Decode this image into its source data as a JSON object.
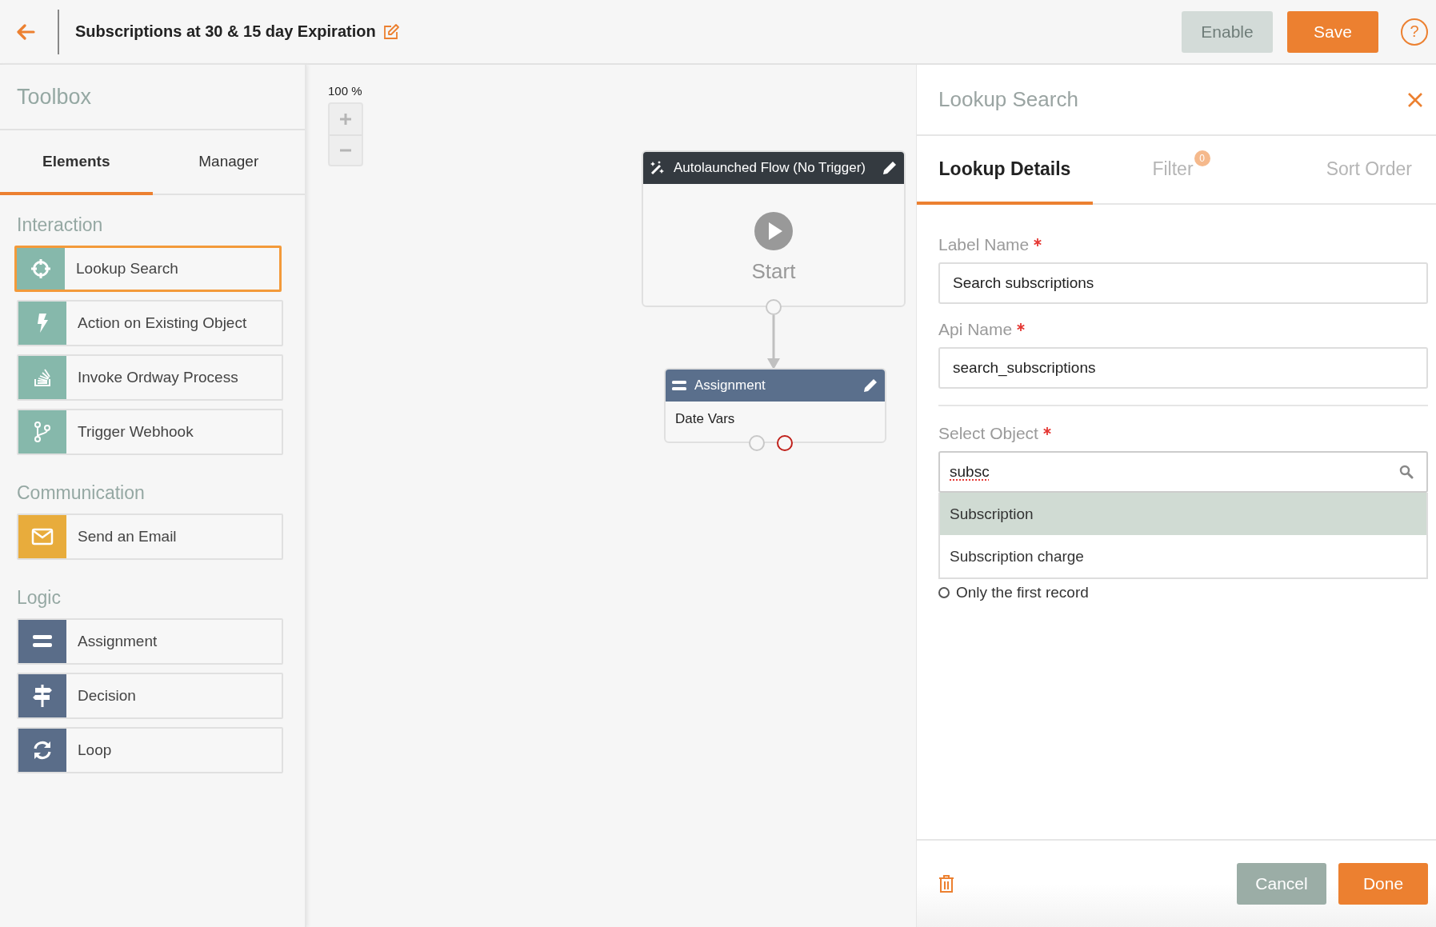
{
  "header": {
    "title": "Subscriptions at 30 & 15 day Expiration",
    "buttons": [
      {
        "label": "Enable",
        "disabled": true,
        "kind": "secondary"
      },
      {
        "label": "Save",
        "disabled": false,
        "kind": "primary"
      }
    ],
    "help": "?"
  },
  "toolbox": {
    "title": "Toolbox",
    "tabs": [
      {
        "label": "Elements",
        "selected": true
      },
      {
        "label": "Manager",
        "selected": false
      }
    ],
    "sections": [
      {
        "title": "Interaction",
        "items": [
          {
            "label": "Lookup Search",
            "color": "#86b8ab",
            "selected": true
          },
          {
            "label": "Action on Existing Object",
            "color": "#86b8ab",
            "selected": false
          },
          {
            "label": "Invoke Ordway Process",
            "color": "#86b8ab",
            "selected": false
          },
          {
            "label": "Trigger Webhook",
            "color": "#86b8ab",
            "selected": false
          }
        ]
      },
      {
        "title": "Communication",
        "items": [
          {
            "label": "Send an Email",
            "color": "#e8ac3c",
            "selected": false
          }
        ]
      },
      {
        "title": "Logic",
        "items": [
          {
            "label": "Assignment",
            "color": "#5a6d89",
            "selected": false
          },
          {
            "label": "Decision",
            "color": "#5a6d89",
            "selected": false
          },
          {
            "label": "Loop",
            "color": "#5a6d89",
            "selected": false
          }
        ]
      }
    ]
  },
  "canvas": {
    "zoom": "100 %",
    "nodes": [
      {
        "kind": "start",
        "title": "Autolaunched Flow (No Trigger)",
        "label": "Start"
      },
      {
        "kind": "assignment",
        "title": "Assignment",
        "label": "Date Vars"
      }
    ]
  },
  "panel": {
    "title": "Lookup Search",
    "tabs": [
      {
        "label": "Lookup Details",
        "selected": true
      },
      {
        "label": "Filter",
        "selected": false,
        "badge": "0"
      },
      {
        "label": "Sort Order",
        "selected": false
      }
    ],
    "fields": [
      {
        "label": "Label Name",
        "required": true,
        "value": "Search subscriptions"
      },
      {
        "label": "Api Name",
        "required": true,
        "value": "search_subscriptions"
      }
    ],
    "select": {
      "label": "Select Object",
      "required": true,
      "value": "subsc",
      "options": [
        {
          "label": "Subscription",
          "selected": true
        },
        {
          "label": "Subscription charge",
          "selected": false
        }
      ]
    },
    "radio": {
      "label": "Only the first record",
      "checked": false
    },
    "buttons": [
      {
        "label": "Cancel",
        "kind": "secondary"
      },
      {
        "label": "Done",
        "kind": "primary"
      }
    ]
  }
}
